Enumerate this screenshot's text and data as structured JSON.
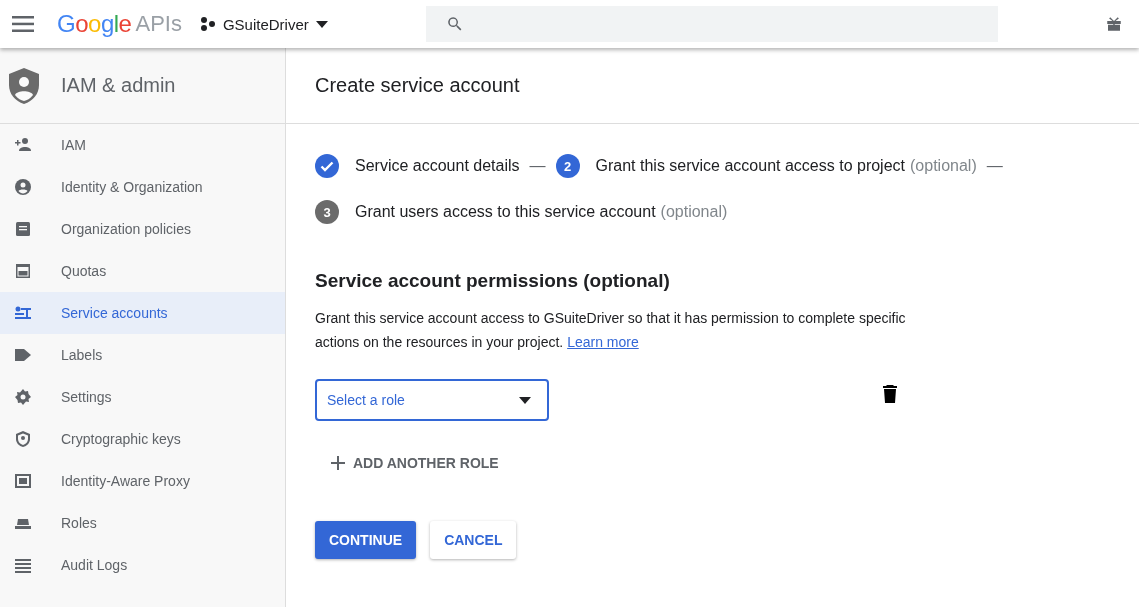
{
  "top_bar": {
    "logo_word": "Google",
    "logo_suffix": "APIs",
    "project": "GSuiteDriver"
  },
  "sidebar": {
    "title": "IAM & admin",
    "items": [
      {
        "label": "IAM",
        "selected": false
      },
      {
        "label": "Identity & Organization",
        "selected": false
      },
      {
        "label": "Organization policies",
        "selected": false
      },
      {
        "label": "Quotas",
        "selected": false
      },
      {
        "label": "Service accounts",
        "selected": true
      },
      {
        "label": "Labels",
        "selected": false
      },
      {
        "label": "Settings",
        "selected": false
      },
      {
        "label": "Cryptographic keys",
        "selected": false
      },
      {
        "label": "Identity-Aware Proxy",
        "selected": false
      },
      {
        "label": "Roles",
        "selected": false
      },
      {
        "label": "Audit Logs",
        "selected": false
      }
    ]
  },
  "page": {
    "title": "Create service account",
    "steps": [
      {
        "kind": "done",
        "label": "Service account details",
        "connector": "—"
      },
      {
        "kind": "active",
        "number": "2",
        "label": "Grant this service account access to project",
        "note": "(optional)",
        "connector": "—"
      },
      {
        "kind": "pending",
        "number": "3",
        "label": "Grant users access to this service account",
        "note": "(optional)"
      }
    ],
    "section_title": "Service account permissions (optional)",
    "description": "Grant this service account access to GSuiteDriver so that it has permission to complete specific actions on the resources in your project.",
    "learn_more": "Learn more",
    "role_select": {
      "placeholder": "Select a role"
    },
    "add_role": "ADD ANOTHER ROLE",
    "buttons": [
      {
        "label": "CONTINUE",
        "kind": "primary"
      },
      {
        "label": "CANCEL",
        "kind": "secondary"
      }
    ]
  }
}
